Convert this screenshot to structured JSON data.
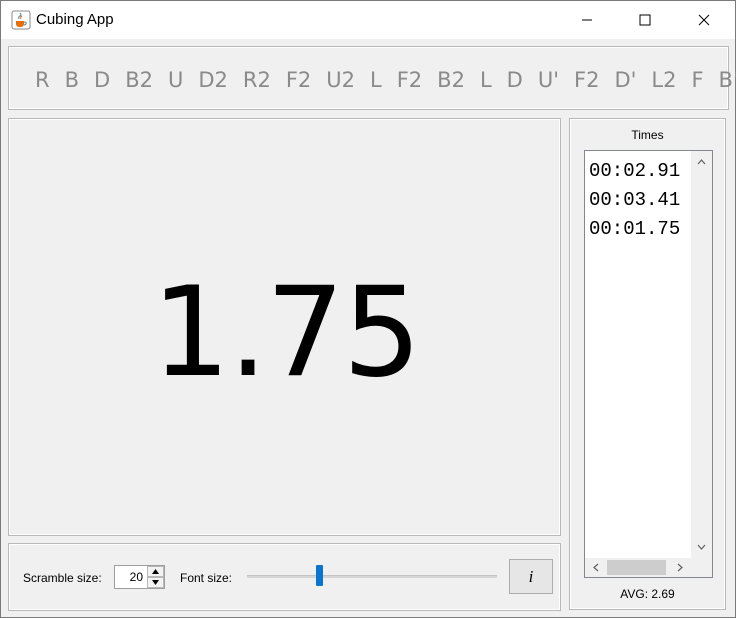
{
  "window": {
    "title": "Cubing App",
    "icon": "java-coffee-cup-icon"
  },
  "scramble": {
    "moves": [
      "R",
      "B",
      "D",
      "B2",
      "U",
      "D2",
      "R2",
      "F2",
      "U2",
      "L",
      "F2",
      "B2",
      "L",
      "D",
      "U'",
      "F2",
      "D'",
      "L2",
      "F",
      "B'"
    ]
  },
  "timer": {
    "display": "1.75"
  },
  "controls": {
    "scramble_size_label": "Scramble size:",
    "scramble_size_value": "20",
    "font_size_label": "Font size:",
    "font_size_level": 0.29,
    "info_button_label": "i"
  },
  "times": {
    "title": "Times",
    "items": [
      "00:02.91",
      "00:03.41",
      "00:01.75"
    ],
    "average_label": "AVG: 2.69"
  },
  "colors": {
    "scramble_text": "#8a8a8a",
    "slider_thumb": "#0a74d1",
    "background": "#f0f0f0"
  }
}
